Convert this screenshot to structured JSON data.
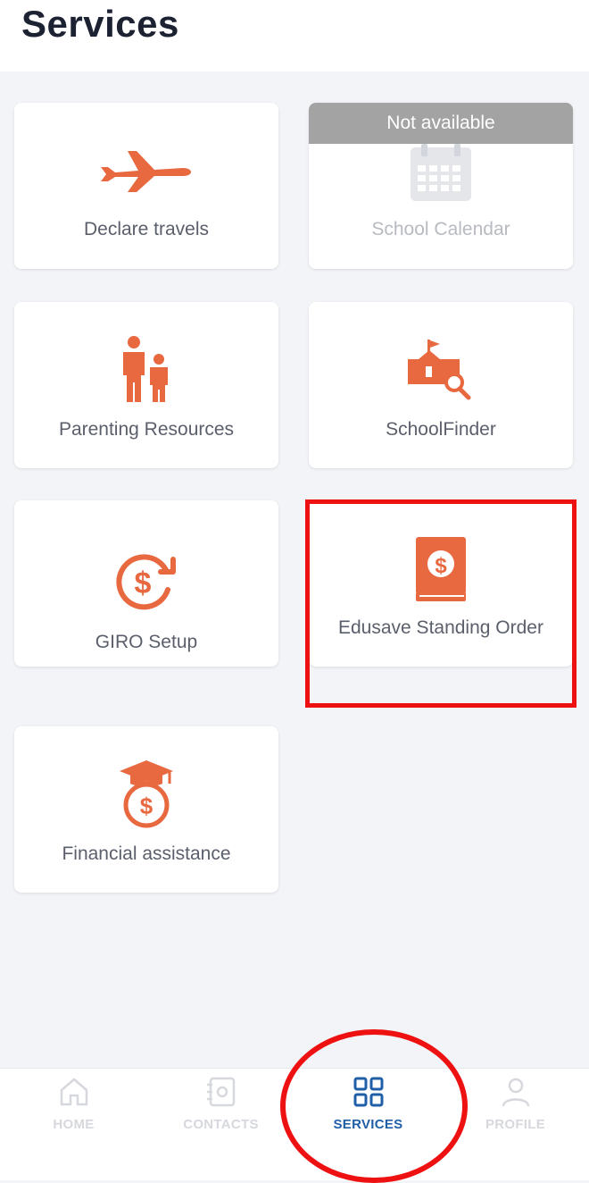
{
  "header": {
    "title": "Services"
  },
  "services": [
    {
      "label": "Declare travels",
      "icon": "airplane-icon"
    },
    {
      "label": "School Calendar",
      "icon": "calendar-icon",
      "badge": "Not available"
    },
    {
      "label": "Parenting Resources",
      "icon": "parent-child-icon"
    },
    {
      "label": "SchoolFinder",
      "icon": "school-search-icon"
    },
    {
      "label": "GIRO Setup",
      "icon": "recurring-dollar-icon"
    },
    {
      "label": "Edusave Standing Order",
      "icon": "dollar-book-icon"
    },
    {
      "label": "Financial assistance",
      "icon": "graduation-money-bag-icon"
    }
  ],
  "nav": {
    "items": [
      {
        "label": "HOME",
        "icon": "home-icon"
      },
      {
        "label": "CONTACTS",
        "icon": "contacts-icon"
      },
      {
        "label": "SERVICES",
        "icon": "grid-icon",
        "active": true
      },
      {
        "label": "PROFILE",
        "icon": "person-icon"
      }
    ]
  },
  "colors": {
    "accent": "#e8683f",
    "active_nav": "#1f5fa8",
    "highlight": "#ee1111",
    "disabled_banner": "#a3a3a3"
  }
}
